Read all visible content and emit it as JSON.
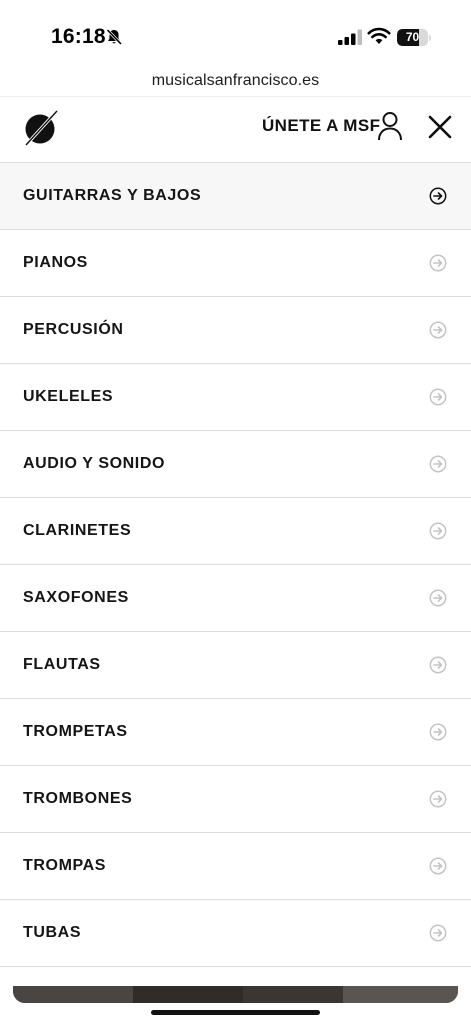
{
  "status_bar": {
    "time": "16:18",
    "battery_percent": "70",
    "battery_level": 0.7,
    "icons": [
      "bell-off-icon",
      "signal-icon",
      "wifi-icon",
      "battery-icon"
    ]
  },
  "browser": {
    "url": "musicalsanfrancisco.es"
  },
  "header": {
    "logo_icon": "brand-logo-icon",
    "join_label": "ÚNETE A MSF",
    "user_icon": "user-icon",
    "close_icon": "close-icon"
  },
  "menu": {
    "items": [
      {
        "label": "GUITARRAS Y BAJOS",
        "active": true
      },
      {
        "label": "PIANOS",
        "active": false
      },
      {
        "label": "PERCUSIÓN",
        "active": false
      },
      {
        "label": "UKELELES",
        "active": false
      },
      {
        "label": "AUDIO Y SONIDO",
        "active": false
      },
      {
        "label": "CLARINETES",
        "active": false
      },
      {
        "label": "SAXOFONES",
        "active": false
      },
      {
        "label": "FLAUTAS",
        "active": false
      },
      {
        "label": "TROMPETAS",
        "active": false
      },
      {
        "label": "TROMBONES",
        "active": false
      },
      {
        "label": "TROMPAS",
        "active": false
      },
      {
        "label": "TUBAS",
        "active": false
      }
    ],
    "arrow_icon": "arrow-right-circle-icon"
  },
  "colors": {
    "text": "#151515",
    "divider": "#dcdcdc",
    "active_bg": "#f7f7f7",
    "arrow_active": "#111111",
    "arrow_inactive": "#c4c4c4"
  }
}
